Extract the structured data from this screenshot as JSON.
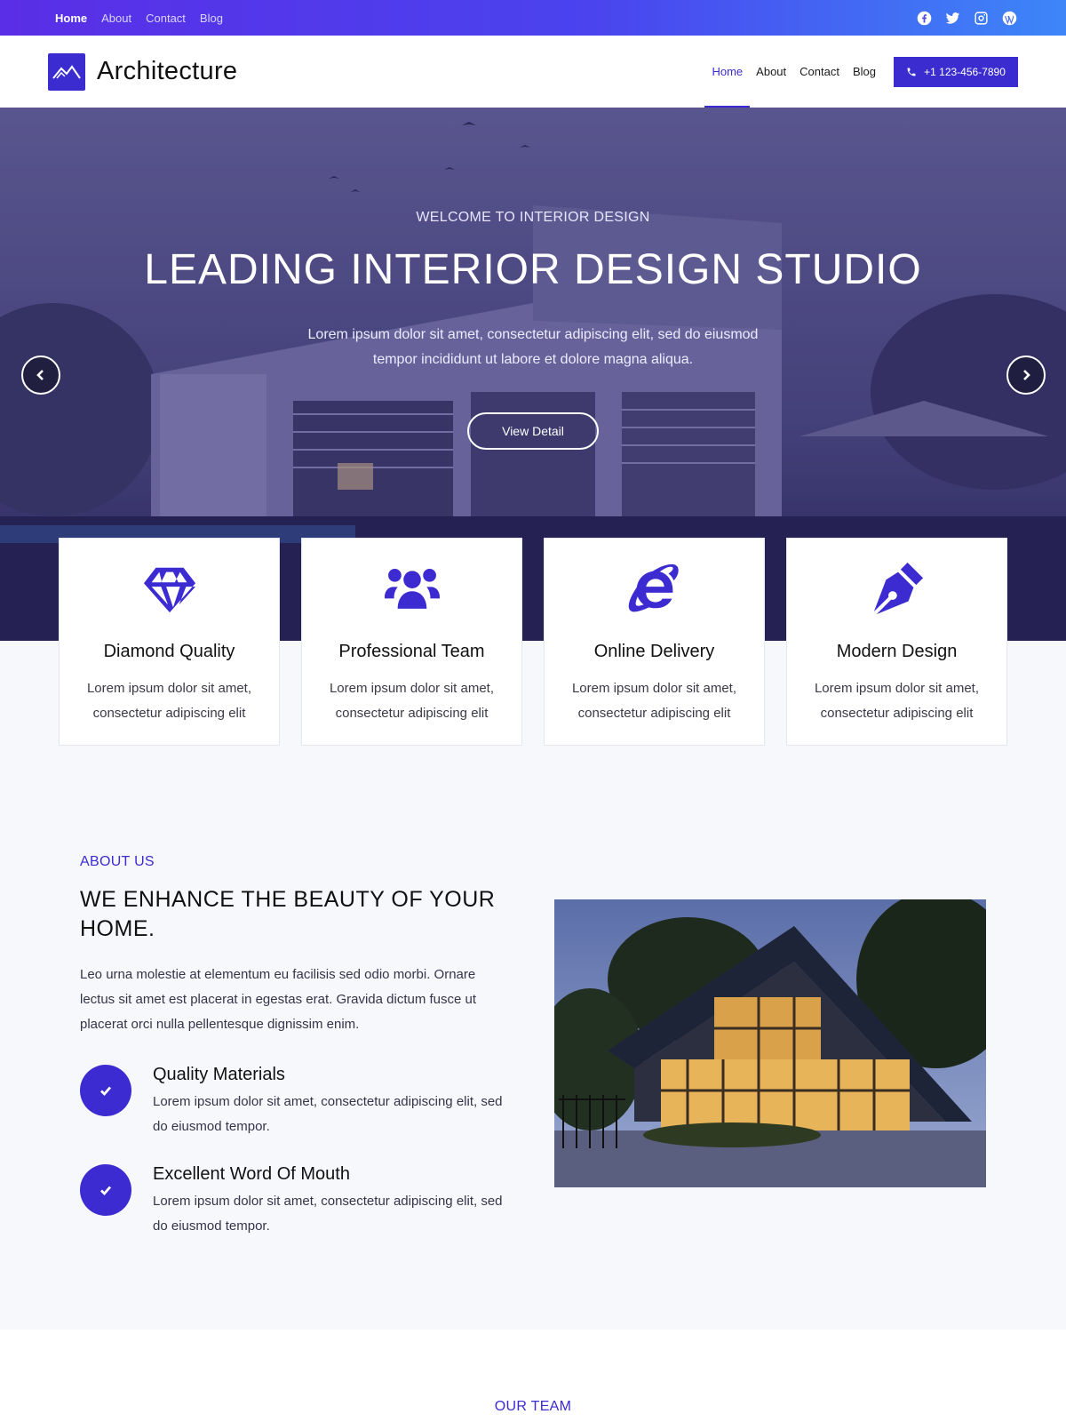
{
  "topbar": {
    "nav": [
      {
        "label": "Home",
        "active": true
      },
      {
        "label": "About",
        "active": false
      },
      {
        "label": "Contact",
        "active": false
      },
      {
        "label": "Blog",
        "active": false
      }
    ],
    "socials": [
      "facebook-icon",
      "twitter-icon",
      "instagram-icon",
      "wordpress-icon"
    ]
  },
  "header": {
    "brand": "Architecture",
    "nav": [
      {
        "label": "Home",
        "active": true
      },
      {
        "label": "About",
        "active": false
      },
      {
        "label": "Contact",
        "active": false
      },
      {
        "label": "Blog",
        "active": false
      }
    ],
    "phone": "+1 123-456-7890"
  },
  "hero": {
    "eyebrow": "WELCOME TO INTERIOR DESIGN",
    "title": "LEADING INTERIOR DESIGN STUDIO",
    "text": "Lorem ipsum dolor sit amet, consectetur adipiscing elit, sed do eiusmod tempor incididunt ut labore et dolore magna aliqua.",
    "button": "View Detail"
  },
  "features": [
    {
      "icon": "diamond-icon",
      "title": "Diamond Quality",
      "text": "Lorem ipsum dolor sit amet, consectetur adipiscing elit"
    },
    {
      "icon": "team-icon",
      "title": "Professional Team",
      "text": "Lorem ipsum dolor sit amet, consectetur adipiscing elit"
    },
    {
      "icon": "internet-explorer-icon",
      "title": "Online Delivery",
      "text": "Lorem ipsum dolor sit amet, consectetur adipiscing elit"
    },
    {
      "icon": "pen-nib-icon",
      "title": "Modern Design",
      "text": "Lorem ipsum dolor sit amet, consectetur adipiscing elit"
    }
  ],
  "about": {
    "eyebrow": "ABOUT US",
    "title": "WE ENHANCE THE BEAUTY OF YOUR HOME.",
    "text": "Leo urna molestie at elementum eu facilisis sed odio morbi. Ornare lectus sit amet est placerat in egestas erat. Gravida dictum fusce ut placerat orci nulla pellentesque dignissim enim.",
    "items": [
      {
        "title": "Quality Materials",
        "text": "Lorem ipsum dolor sit amet, consectetur adipiscing elit, sed do eiusmod tempor."
      },
      {
        "title": "Excellent Word Of Mouth",
        "text": "Lorem ipsum dolor sit amet, consectetur adipiscing elit, sed do eiusmod tempor."
      }
    ]
  },
  "team": {
    "eyebrow": "OUR TEAM"
  },
  "colors": {
    "accent": "#3b2bd0",
    "topbar_start": "#5a2ee6",
    "topbar_end": "#3d86f8"
  }
}
